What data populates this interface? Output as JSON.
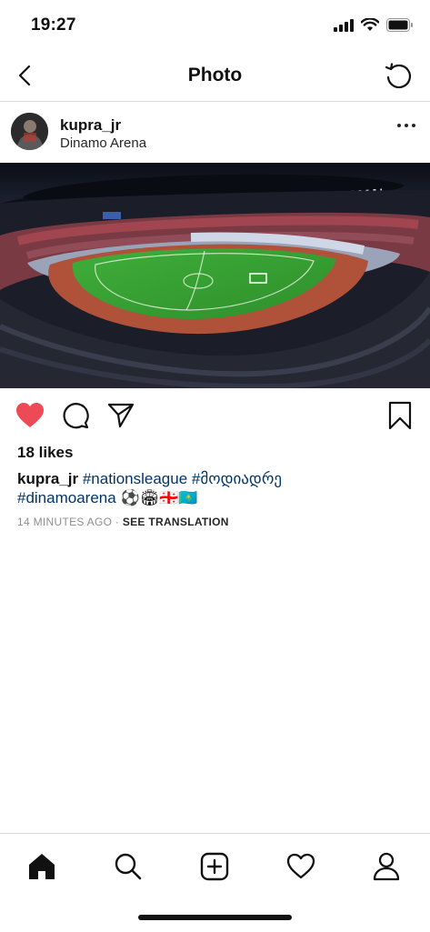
{
  "status": {
    "time": "19:27"
  },
  "nav": {
    "title": "Photo"
  },
  "post": {
    "username": "kupra_jr",
    "location": "Dinamo Arena",
    "likes": "18 likes",
    "caption": {
      "user": "kupra_jr",
      "tag1": "#nationsleague",
      "tag2": "#მოდიადრე",
      "tag3": "#dinamoarena",
      "emojis": "⚽🏟🇬🇪🇰🇿"
    },
    "time_ago": "14 MINUTES AGO",
    "separator": "·",
    "see_translation": "SEE TRANSLATION",
    "liked": true
  },
  "colors": {
    "like_red": "#ed4956",
    "hashtag_blue": "#003569"
  },
  "icons": {
    "nav": [
      "back-icon",
      "refresh-icon"
    ],
    "actions": [
      "heart-icon",
      "comment-icon",
      "share-icon",
      "bookmark-icon"
    ],
    "tabs": [
      "home-icon",
      "search-icon",
      "new-post-icon",
      "activity-icon",
      "profile-icon"
    ]
  }
}
